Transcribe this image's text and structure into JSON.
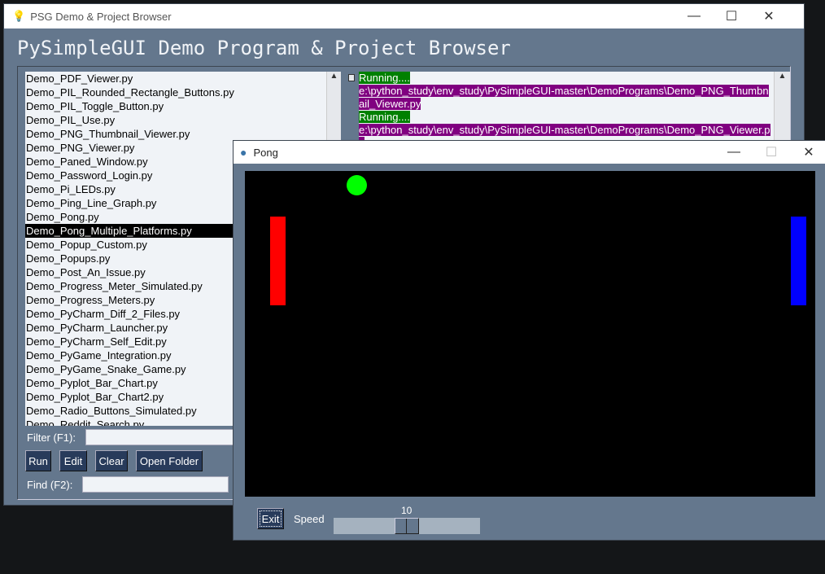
{
  "main_window": {
    "title": "PSG Demo & Project Browser",
    "heading": "PySimpleGUI Demo Program & Project Browser",
    "files": [
      "Demo_PDF_Viewer.py",
      "Demo_PIL_Rounded_Rectangle_Buttons.py",
      "Demo_PIL_Toggle_Button.py",
      "Demo_PIL_Use.py",
      "Demo_PNG_Thumbnail_Viewer.py",
      "Demo_PNG_Viewer.py",
      "Demo_Paned_Window.py",
      "Demo_Password_Login.py",
      "Demo_Pi_LEDs.py",
      "Demo_Ping_Line_Graph.py",
      "Demo_Pong.py",
      "Demo_Pong_Multiple_Platforms.py",
      "Demo_Popup_Custom.py",
      "Demo_Popups.py",
      "Demo_Post_An_Issue.py",
      "Demo_Progress_Meter_Simulated.py",
      "Demo_Progress_Meters.py",
      "Demo_PyCharm_Diff_2_Files.py",
      "Demo_PyCharm_Launcher.py",
      "Demo_PyCharm_Self_Edit.py",
      "Demo_PyGame_Integration.py",
      "Demo_PyGame_Snake_Game.py",
      "Demo_Pyplot_Bar_Chart.py",
      "Demo_Pyplot_Bar_Chart2.py",
      "Demo_Radio_Buttons_Simulated.py",
      "Demo_Reddit_Search.py"
    ],
    "selected_file": "Demo_Pong_Multiple_Platforms.py",
    "output": [
      {
        "text": "Running....",
        "style": "g"
      },
      {
        "text": "e:\\python_study\\env_study\\PySimpleGUI-master\\DemoPrograms\\Demo_PNG_Thumbnail_Viewer.py",
        "style": "p"
      },
      {
        "text": "Running....",
        "style": "g"
      },
      {
        "text": "e:\\python_study\\env_study\\PySimpleGUI-master\\DemoPrograms\\Demo_PNG_Viewer.py",
        "style": "p"
      }
    ],
    "filter_label": "Filter (F1):",
    "filter_value": "",
    "find_label": "Find (F2):",
    "find_value": "",
    "buttons": {
      "run": "Run",
      "edit": "Edit",
      "clear": "Clear",
      "open_folder": "Open Folder"
    }
  },
  "pong_window": {
    "title": "Pong",
    "exit_label": "Exit",
    "speed_label": "Speed",
    "speed_value": "10",
    "colors": {
      "ball": "#00ff00",
      "left_paddle": "#ff0000",
      "right_paddle": "#0000ff",
      "canvas": "#000000"
    }
  }
}
